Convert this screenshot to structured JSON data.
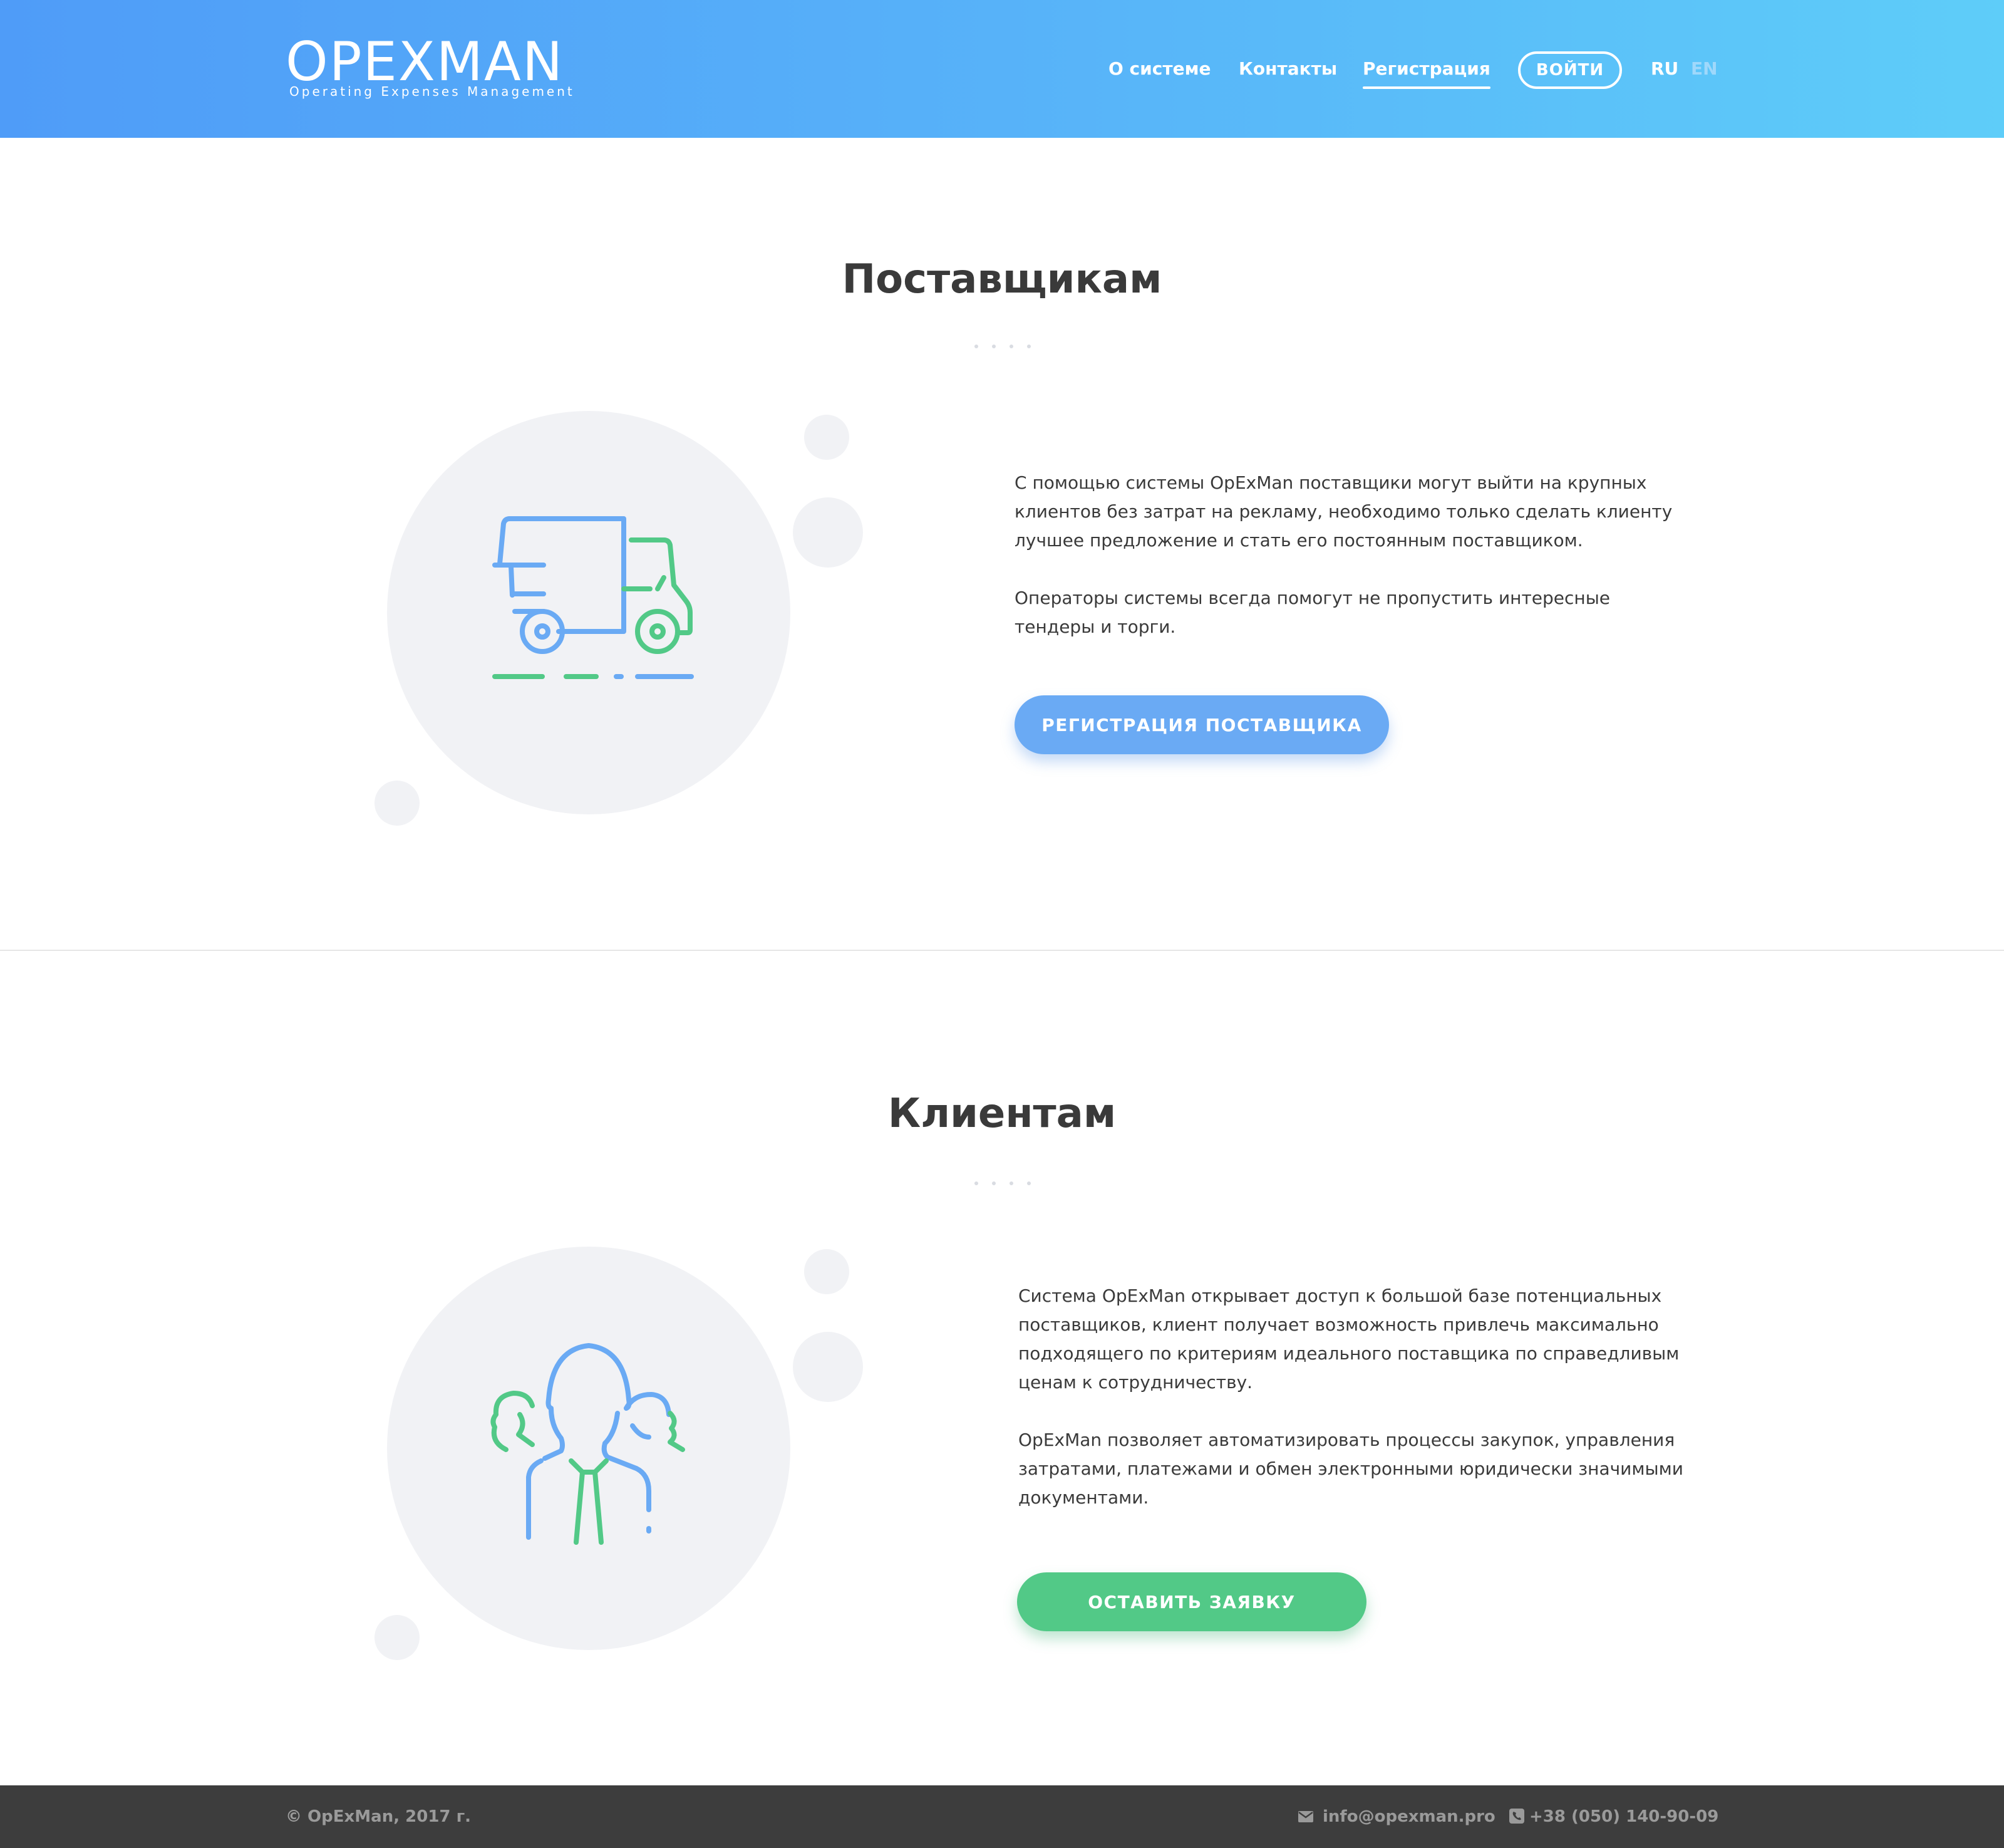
{
  "header": {
    "logo": {
      "word": "OPEXMAN",
      "tagline": "Operating Expenses Management"
    },
    "nav": [
      {
        "label": "О системе"
      },
      {
        "label": "Контакты"
      },
      {
        "label": "Регистрация",
        "active": true
      }
    ],
    "login_label": "ВОЙТИ",
    "languages": [
      {
        "code": "RU",
        "active": true
      },
      {
        "code": "EN",
        "active": false
      }
    ]
  },
  "suppliers": {
    "title": "Поставщикам",
    "icon": "delivery-truck-icon",
    "paragraphs": [
      "С помощью системы OpExMan поставщики могут выйти на крупных\nклиентов без затрат на рекламу, необходимо только сделать клиенту\nлучшее предложение и стать его постоянным поставщиком.",
      "Операторы системы всегда помогут не пропустить интересные\nтендеры и торги."
    ],
    "cta_label": "РЕГИСТРАЦИЯ ПОСТАВЩИКА"
  },
  "clients": {
    "title": "Клиентам",
    "icon": "business-team-icon",
    "paragraphs": [
      "Система OpExMan открывает доступ к большой базе потенциальных\nпоставщиков, клиент получает возможность привлечь максимально\nподходящего по критериям идеального поставщика по справедливым\nценам к сотрудничеству.",
      "OpExMan позволяет автоматизировать процессы закупок, управления\nзатратами, платежами и обмен электронными юридически значимыми\nдокументами."
    ],
    "cta_label": "ОСТАВИТЬ ЗАЯВКУ"
  },
  "footer": {
    "copyright": "© OpExMan, 2017 г.",
    "email": "info@opexman.pro",
    "phone": "+38 (050) 140-90-09"
  },
  "colors": {
    "header_gradient_start": "#4f9cf8",
    "header_gradient_end": "#5ecdf9",
    "accent_blue": "#6aaaf4",
    "accent_green": "#52c987",
    "footer_bg": "#3d3d3d",
    "bubble": "#f1f2f5"
  }
}
